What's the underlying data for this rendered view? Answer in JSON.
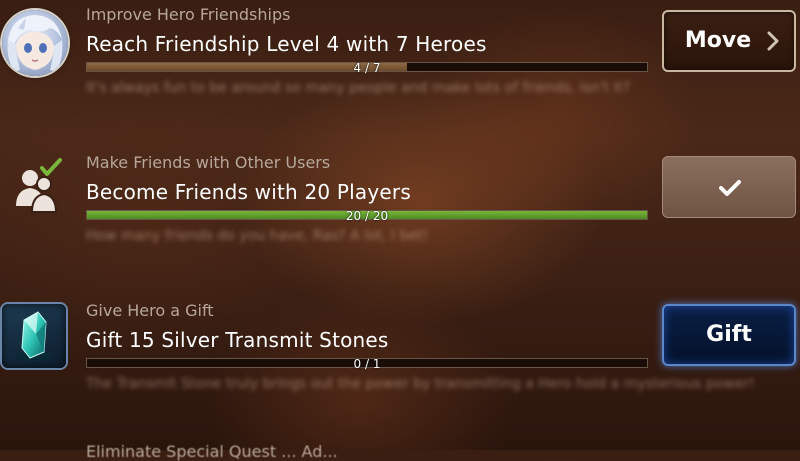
{
  "quests": [
    {
      "category": "Improve Hero Friendships",
      "title": "Reach Friendship Level 4 with 7 Heroes",
      "progress_text": "4 / 7",
      "progress": 0.571,
      "description": "It's always fun to be around so many people and make lots of friends, isn't it?",
      "icon": "hero-avatar",
      "button": {
        "label": "Move",
        "icon": "chevron-right-icon"
      }
    },
    {
      "category": "Make Friends with Other Users",
      "title": "Become Friends with 20 Players",
      "progress_text": "20 / 20",
      "progress": 1.0,
      "description": "How many friends do you have, Ras? A lot, I bet!",
      "icon": "friends-icon",
      "button": {
        "label": "",
        "icon": "checkmark-icon",
        "state": "completed"
      }
    },
    {
      "category": "Give Hero a Gift",
      "title": "Gift 15 Silver Transmit Stones",
      "progress_text": "0 / 1",
      "progress": 0.0,
      "description": "The Transmit Stone truly brings out the power by transmitting a Hero hold a mysterious power!",
      "icon": "transmit-stone-icon",
      "button": {
        "label": "Gift"
      }
    },
    {
      "category": "Eliminate Special Quest ... Ad..."
    }
  ],
  "colors": {
    "progress_in_progress": "#8f6a44",
    "progress_complete": "#79b63b",
    "gift_button_glow": "#5b86c8",
    "completed_check": "#79b63b"
  }
}
